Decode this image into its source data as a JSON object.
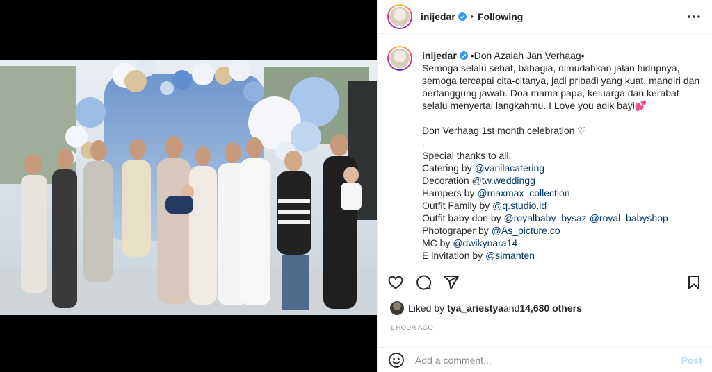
{
  "post": {
    "username": "inijedar",
    "follow_status": "Following",
    "separator": "•"
  },
  "caption": {
    "username": "inijedar",
    "lines": [
      {
        "parts": [
          {
            "text": " •Don Azaiah Jan Verhaag•",
            "link": false
          }
        ]
      },
      {
        "parts": [
          {
            "text": "Semoga selalu sehat, bahagia, dimudahkan jalan hidupnya,",
            "link": false
          }
        ]
      },
      {
        "parts": [
          {
            "text": "semoga tercapai cita-citanya, jadi pribadi yang kuat, mandiri dan",
            "link": false
          }
        ]
      },
      {
        "parts": [
          {
            "text": "bertanggung jawab. Doa mama papa, keluarga dan kerabat",
            "link": false
          }
        ]
      },
      {
        "parts": [
          {
            "text": "selalu menyertai langkahmu. I Love you adik bayi💕",
            "link": false
          }
        ]
      },
      {
        "parts": [
          {
            "text": "",
            "link": false
          }
        ]
      },
      {
        "parts": [
          {
            "text": "Don Verhaag 1st month celebration ♡",
            "link": false
          }
        ]
      },
      {
        "parts": [
          {
            "text": ".",
            "link": false
          }
        ]
      },
      {
        "parts": [
          {
            "text": "Special thanks to all;",
            "link": false
          }
        ]
      },
      {
        "parts": [
          {
            "text": "Catering by ",
            "link": false
          },
          {
            "text": "@vanilacatering",
            "link": true
          }
        ]
      },
      {
        "parts": [
          {
            "text": "Decoration ",
            "link": false
          },
          {
            "text": "@tw.weddingg",
            "link": true
          }
        ]
      },
      {
        "parts": [
          {
            "text": "Hampers by ",
            "link": false
          },
          {
            "text": "@maxmax_collection",
            "link": true
          }
        ]
      },
      {
        "parts": [
          {
            "text": "Outfit Family by ",
            "link": false
          },
          {
            "text": "@q.studio.id",
            "link": true
          }
        ]
      },
      {
        "parts": [
          {
            "text": "Outfit baby don by ",
            "link": false
          },
          {
            "text": "@royalbaby_bysaz",
            "link": true
          },
          {
            "text": " ",
            "link": false
          },
          {
            "text": "@royal_babyshop",
            "link": true
          }
        ]
      },
      {
        "parts": [
          {
            "text": "Photograper by ",
            "link": false
          },
          {
            "text": "@As_picture.co",
            "link": true
          }
        ]
      },
      {
        "parts": [
          {
            "text": "MC by ",
            "link": false
          },
          {
            "text": "@dwikynara14",
            "link": true
          }
        ]
      },
      {
        "parts": [
          {
            "text": "E invitation by ",
            "link": false
          },
          {
            "text": "@simanten",
            "link": true
          }
        ]
      }
    ]
  },
  "icons": {
    "more": "more-options-icon",
    "like": "heart-icon",
    "comment": "comment-icon",
    "share": "share-icon",
    "save": "bookmark-icon",
    "emoji": "emoji-icon",
    "verified": "verified-badge-icon"
  },
  "likes": {
    "prefix": "Liked by ",
    "first_user": "tya_ariestya",
    "conjunction": " and ",
    "others": "14,680 others"
  },
  "timestamp": "1 hour ago",
  "comment": {
    "placeholder": "Add a comment...",
    "post_label": "Post"
  },
  "colors": {
    "link": "#00376b",
    "verified": "#3897f0",
    "post_disabled": "#b2dffc",
    "muted": "#8e8e8e"
  }
}
